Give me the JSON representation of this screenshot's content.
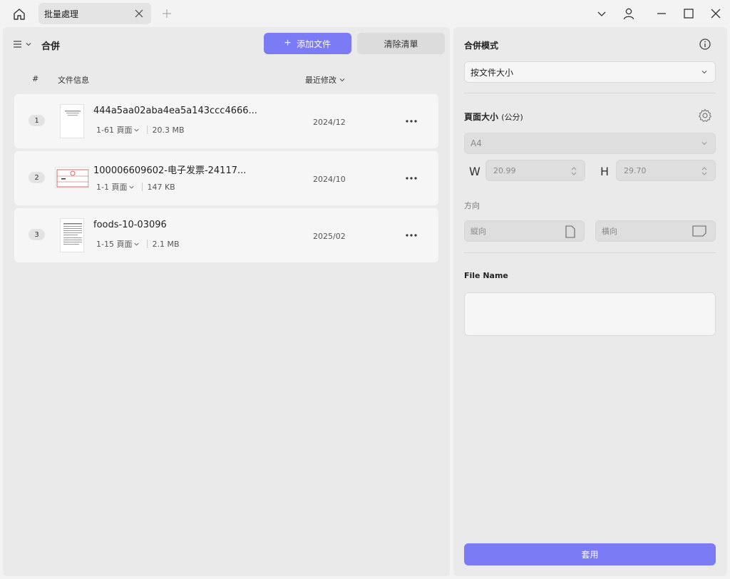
{
  "titlebar": {
    "tab_label": "批量處理"
  },
  "toolbar": {
    "title": "合併",
    "add_label": "添加文件",
    "clear_label": "清除清單"
  },
  "list_header": {
    "num": "#",
    "info": "文件信息",
    "sort": "最近修改"
  },
  "files": [
    {
      "index": "1",
      "name": "444a5aa02aba4ea5a143ccc4666...",
      "pages": "1-61 頁面",
      "size": "20.3 MB",
      "date": "2024/12"
    },
    {
      "index": "2",
      "name": "100006609602-电子发票-24117...",
      "pages": "1-1 頁面",
      "size": "147 KB",
      "date": "2024/10"
    },
    {
      "index": "3",
      "name": "foods-10-03096",
      "pages": "1-15 頁面",
      "size": "2.1 MB",
      "date": "2025/02"
    }
  ],
  "settings": {
    "merge_mode_label": "合併模式",
    "merge_mode_value": "按文件大小",
    "page_size_label": "頁面大小",
    "page_size_unit": "(公分)",
    "page_size_value": "A4",
    "width_letter": "W",
    "width_value": "20.99",
    "height_letter": "H",
    "height_value": "29.70",
    "orientation_label": "方向",
    "portrait_label": "縱向",
    "landscape_label": "橫向",
    "file_name_label": "File Name",
    "file_name_value": "",
    "apply_label": "套用"
  },
  "colors": {
    "accent": "#7b7bf5",
    "panel_bg": "#eaeaea",
    "row_bg": "#f6f6f6"
  }
}
